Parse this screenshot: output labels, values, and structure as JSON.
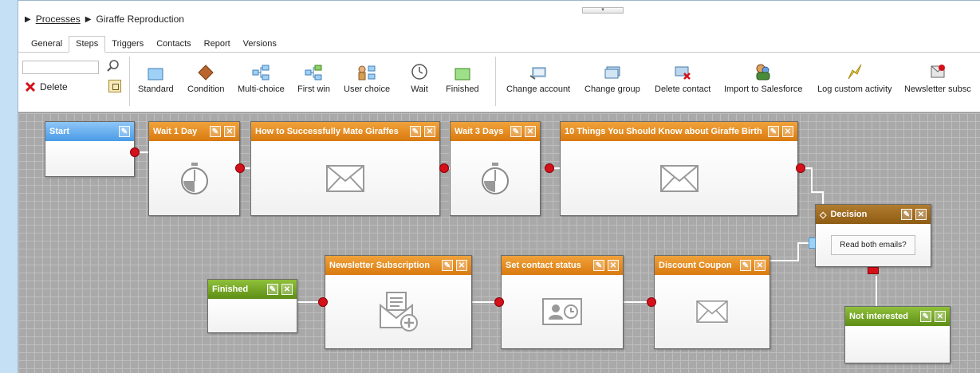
{
  "breadcrumb": {
    "root": "Processes",
    "current": "Giraffe Reproduction"
  },
  "tabs": [
    "General",
    "Steps",
    "Triggers",
    "Contacts",
    "Report",
    "Versions"
  ],
  "active_tab": "Steps",
  "toolbar": {
    "search_value": "",
    "delete_label": "Delete",
    "tools": [
      {
        "label": "Standard",
        "icon": "standard-step-icon"
      },
      {
        "label": "Condition",
        "icon": "condition-diamond-icon"
      },
      {
        "label": "Multi-choice",
        "icon": "multi-choice-icon"
      },
      {
        "label": "First win",
        "icon": "first-win-icon"
      },
      {
        "label": "User choice",
        "icon": "user-choice-icon"
      },
      {
        "label": "Wait",
        "icon": "clock-icon"
      },
      {
        "label": "Finished",
        "icon": "finished-icon"
      },
      {
        "label": "Change account",
        "icon": "change-account-icon"
      },
      {
        "label": "Change group",
        "icon": "change-group-icon"
      },
      {
        "label": "Delete contact",
        "icon": "delete-contact-icon"
      },
      {
        "label": "Import to Salesforce",
        "icon": "salesforce-icon"
      },
      {
        "label": "Log custom activity",
        "icon": "log-activity-icon"
      },
      {
        "label": "Newsletter subsc",
        "icon": "newsletter-icon"
      }
    ]
  },
  "nodes": {
    "start": "Start",
    "wait1": "Wait 1 Day",
    "email1": "How to Successfully Mate Giraffes",
    "wait3": "Wait 3 Days",
    "email2": "10 Things You Should Know about Giraffe Birth",
    "decision": "Decision",
    "decision_text": "Read both emails?",
    "coupon": "Discount Coupon",
    "status": "Set contact status",
    "newsletter": "Newsletter Subscription",
    "finished": "Finished",
    "not_interested": "Not interested"
  },
  "colors": {
    "step_header": "#e08a1e",
    "start_header": "#5aa5ea",
    "finish_header": "#6e9e1e",
    "connector": "#d4101a"
  }
}
